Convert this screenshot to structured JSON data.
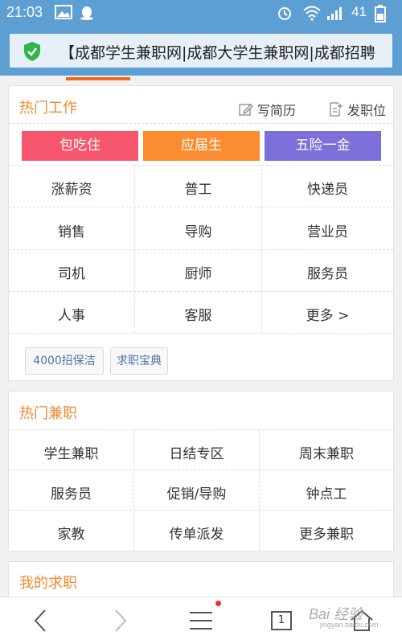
{
  "status_bar": {
    "time": "21:03",
    "battery": "41"
  },
  "browser": {
    "url_text": "【成都学生兼职网|成都大学生兼职网|成都招聘"
  },
  "colors": {
    "accent": "#f08a32",
    "tag_red": "#f5566d",
    "tag_orange": "#fb8c2f",
    "tag_purple": "#7d6fda",
    "status_blue": "#5d9fd3"
  },
  "hot_jobs": {
    "title": "热门工作",
    "write_resume": "写简历",
    "post_job": "发职位",
    "tags": [
      "包吃住",
      "应届生",
      "五险一金"
    ],
    "grid": [
      [
        "涨薪资",
        "普工",
        "快递员"
      ],
      [
        "销售",
        "导购",
        "营业员"
      ],
      [
        "司机",
        "厨师",
        "服务员"
      ],
      [
        "人事",
        "客服",
        "更多 >"
      ]
    ],
    "pills": [
      "4000招保洁",
      "求职宝典"
    ]
  },
  "hot_parttime": {
    "title": "热门兼职",
    "grid": [
      [
        "学生兼职",
        "日结专区",
        "周末兼职"
      ],
      [
        "服务员",
        "促销/导购",
        "钟点工"
      ],
      [
        "家教",
        "传单派发",
        "更多兼职"
      ]
    ]
  },
  "my_jobs": {
    "title": "我的求职"
  },
  "bottom_nav": {
    "tab_count": "1"
  },
  "watermark": {
    "brand": "Bai 经验",
    "url": "jingyan.baidu.com"
  }
}
